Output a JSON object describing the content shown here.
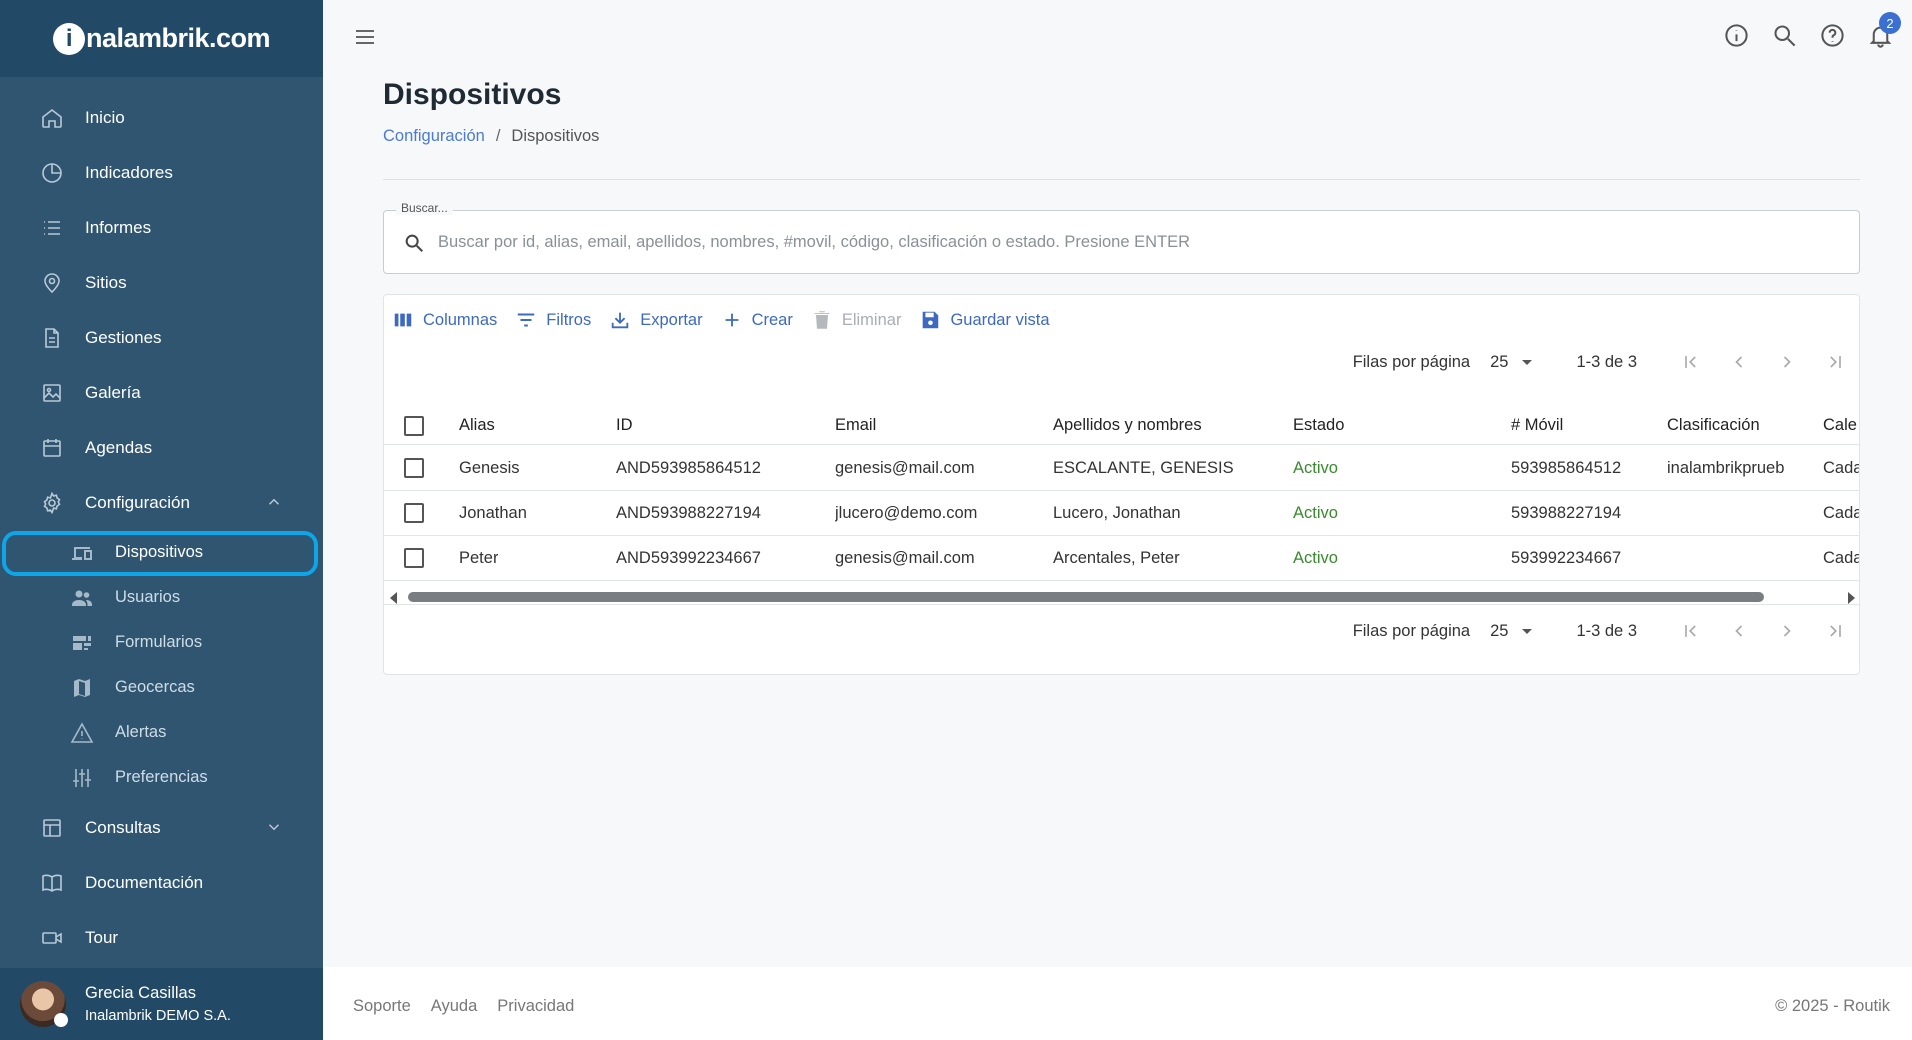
{
  "brand": {
    "logo_text_i": "i",
    "logo_text_rest": "nalambrik.com"
  },
  "sidebar": {
    "items": [
      {
        "label": "Inicio",
        "icon": "home-icon"
      },
      {
        "label": "Indicadores",
        "icon": "pie-chart-icon"
      },
      {
        "label": "Informes",
        "icon": "list-icon"
      },
      {
        "label": "Sitios",
        "icon": "location-pin-icon"
      },
      {
        "label": "Gestiones",
        "icon": "document-icon"
      },
      {
        "label": "Galería",
        "icon": "image-icon"
      },
      {
        "label": "Agendas",
        "icon": "calendar-icon"
      },
      {
        "label": "Configuración",
        "icon": "gear-icon",
        "expanded": true
      }
    ],
    "sub_items": [
      {
        "label": "Dispositivos",
        "icon": "devices-icon",
        "active": true
      },
      {
        "label": "Usuarios",
        "icon": "users-icon"
      },
      {
        "label": "Formularios",
        "icon": "form-icon"
      },
      {
        "label": "Geocercas",
        "icon": "map-icon"
      },
      {
        "label": "Alertas",
        "icon": "warning-icon"
      },
      {
        "label": "Preferencias",
        "icon": "sliders-icon"
      }
    ],
    "bottom_items": [
      {
        "label": "Consultas",
        "icon": "table-icon",
        "expanded": false
      },
      {
        "label": "Documentación",
        "icon": "book-icon"
      },
      {
        "label": "Tour",
        "icon": "video-icon"
      }
    ],
    "user": {
      "name": "Grecia Casillas",
      "org": "Inalambrik DEMO S.A."
    }
  },
  "topbar": {
    "notifications_count": "2"
  },
  "page": {
    "title": "Dispositivos",
    "breadcrumb": {
      "parent": "Configuración",
      "separator": "/",
      "current": "Dispositivos"
    }
  },
  "search": {
    "label": "Buscar...",
    "placeholder": "Buscar por id, alias, email, apellidos, nombres, #movil, código, clasificación o estado. Presione ENTER"
  },
  "toolbar": {
    "columns": "Columnas",
    "filters": "Filtros",
    "export": "Exportar",
    "create": "Crear",
    "delete": "Eliminar",
    "save_view": "Guardar vista"
  },
  "pagination": {
    "rows_label": "Filas por página",
    "rows_value": "25",
    "range": "1-3 de 3"
  },
  "table": {
    "columns": [
      "Alias",
      "ID",
      "Email",
      "Apellidos y nombres",
      "Estado",
      "# Móvil",
      "Clasificación",
      "Cale"
    ],
    "rows": [
      [
        "Genesis",
        "AND593985864512",
        "genesis@mail.com",
        "ESCALANTE, GENESIS",
        "Activo",
        "593985864512",
        "inalambrikprueb",
        "Cada"
      ],
      [
        "Jonathan",
        "AND593988227194",
        "jlucero@demo.com",
        "Lucero, Jonathan",
        "Activo",
        "593988227194",
        "",
        "Cada"
      ],
      [
        "Peter",
        "AND593992234667",
        "genesis@mail.com",
        "Arcentales, Peter",
        "Activo",
        "593992234667",
        "",
        "Cada"
      ]
    ]
  },
  "footer": {
    "links": [
      "Soporte",
      "Ayuda",
      "Privacidad"
    ],
    "copyright": "© 2025 - Routik"
  },
  "colors": {
    "sidebar": "#2f5570",
    "brand_bar": "#224a66",
    "accent": "#3d6ac0",
    "active_outline": "#0ea5e9",
    "status_active": "#3a8a2f"
  }
}
